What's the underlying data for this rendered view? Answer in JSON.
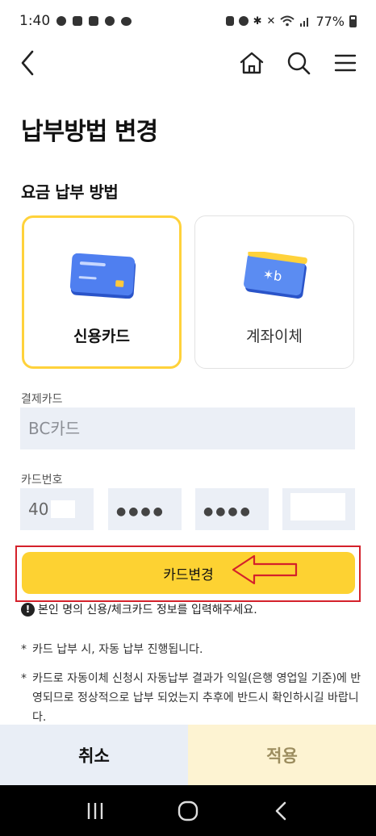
{
  "status_bar": {
    "time": "1:40",
    "battery": "77%"
  },
  "app_bar": {
    "back_icon": "chevron-left-icon",
    "home_icon": "home-icon",
    "search_icon": "search-icon",
    "menu_icon": "hamburger-menu-icon"
  },
  "page": {
    "title": "납부방법 변경",
    "section_title": "요금 납부 방법"
  },
  "methods": [
    {
      "label": "신용카드",
      "selected": true,
      "icon": "credit-card-icon"
    },
    {
      "label": "계좌이체",
      "selected": false,
      "icon": "bankbook-icon"
    }
  ],
  "card_company": {
    "label": "결제카드",
    "value": "BC카드"
  },
  "card_number": {
    "label": "카드번호",
    "part1": "40",
    "part2": "●●●●",
    "part3": "●●●●",
    "part4": ""
  },
  "change_button": {
    "label": "카드변경"
  },
  "notice": {
    "icon": "exclamation-icon",
    "text": "본인 명의 신용/체크카드 정보를 입력해주세요."
  },
  "bullets": [
    {
      "marker": "*",
      "text": "카드 납부 시, 자동 납부 진행됩니다."
    },
    {
      "marker": "*",
      "text": "카드로 자동이체 신청시 자동납부 결과가 익일(은행 영업일 기준)에 반영되므로 정상적으로 납부 되었는지 추후에 반드시 확인하시길 바랍니다."
    }
  ],
  "bottom": {
    "cancel": "취소",
    "apply": "적용"
  },
  "colors": {
    "accent_yellow": "#FDD232",
    "annotation_red": "#D4212B",
    "field_bg": "#EBEFF6"
  }
}
